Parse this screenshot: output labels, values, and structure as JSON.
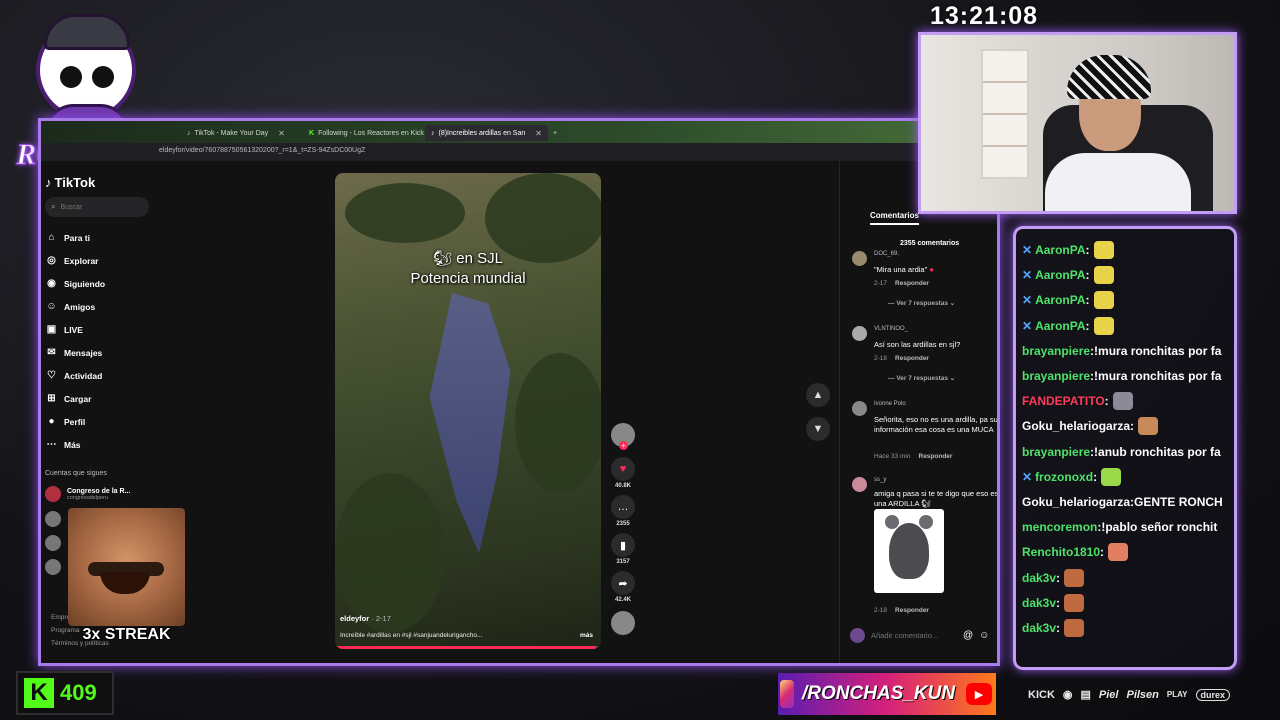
{
  "overlay": {
    "clock": "13:21:08",
    "logo_text": "RONCHAS",
    "streak_label": "3x STREAK",
    "kick_count": "409",
    "social_handle": "/RONCHAS_KUN",
    "sponsors": [
      "KICK",
      "Piel",
      "Pilsen",
      "PLAY",
      "durex"
    ]
  },
  "browser": {
    "tabs": [
      {
        "label": "TikTok - Make Your Day",
        "active": false
      },
      {
        "label": "Following - Los Reactores en Kick",
        "active": false
      },
      {
        "label": "(8)Increibles ardillas en San",
        "active": true
      }
    ],
    "url": "eldeyfor/video/760788750561320200?_r=1&_t=ZS-94ZsDC00UgZ"
  },
  "tiktok": {
    "brand": "TikTok",
    "search_placeholder": "Buscar",
    "nav": [
      {
        "label": "Para ti",
        "icon": "home-icon"
      },
      {
        "label": "Explorar",
        "icon": "compass-icon"
      },
      {
        "label": "Siguiendo",
        "icon": "following-icon"
      },
      {
        "label": "Amigos",
        "icon": "friends-icon"
      },
      {
        "label": "LIVE",
        "icon": "live-icon"
      },
      {
        "label": "Mensajes",
        "icon": "messages-icon"
      },
      {
        "label": "Actividad",
        "icon": "activity-icon"
      },
      {
        "label": "Cargar",
        "icon": "upload-icon"
      },
      {
        "label": "Perfil",
        "icon": "profile-icon"
      },
      {
        "label": "Más",
        "icon": "more-icon"
      }
    ],
    "following_title": "Cuentas que sigues",
    "following": [
      {
        "name": "Congreso de la R...",
        "handle": "congresodelperu"
      }
    ],
    "footer_links": [
      "Empresa",
      "Programa",
      "Términos y políticas"
    ]
  },
  "video": {
    "caption_line1": "en SJL",
    "caption_line2": "Potencia mundial",
    "author": "eldeyfor",
    "date": "· 2-17",
    "description": "Increíble #ardillas en #sjl #sanjuandelurigancho...",
    "more": "más",
    "progress": 0.98,
    "likes": "40.8K",
    "comments": "2355",
    "saves": "3157",
    "shares": "42.4K"
  },
  "comments_panel": {
    "tab": "Comentarios",
    "count_label": "2355 comentarios",
    "items": [
      {
        "user": "DOC_69.",
        "text": "\"Mira una ardia\"",
        "date": "2-17",
        "reply": "Responder",
        "more": "Ver 7 respuestas"
      },
      {
        "user": "VLNTINOO_",
        "text": "Así son las ardillas en sjl?",
        "date": "2-18",
        "reply": "Responder",
        "more": "Ver 7 respuestas"
      },
      {
        "user": "Ivonne Polo",
        "text": "Señorita, eso no es una ardilla, pa su información esa cosa es una MUCA",
        "date": "Hace 33 min",
        "reply": "Responder"
      },
      {
        "user": "ss_y",
        "text": "amiga q pasa si te te digo que eso es una ARDILLA",
        "date": "2-18",
        "reply": "Responder"
      }
    ],
    "input_placeholder": "Añadir comentario..."
  },
  "chat": {
    "messages": [
      {
        "user": "AaronPA",
        "text": "",
        "color": "#4de36a",
        "badge": true,
        "emote": "#e8d44a"
      },
      {
        "user": "AaronPA",
        "text": "",
        "color": "#4de36a",
        "badge": true,
        "emote": "#e8d44a"
      },
      {
        "user": "AaronPA",
        "text": "",
        "color": "#4de36a",
        "badge": true,
        "emote": "#e8d44a"
      },
      {
        "user": "AaronPA",
        "text": "",
        "color": "#4de36a",
        "badge": true,
        "emote": "#e8d44a"
      },
      {
        "user": "brayanpiere",
        "text": "!mura ronchitas por fa",
        "color": "#4de36a",
        "badge": false
      },
      {
        "user": "brayanpiere",
        "text": "!mura ronchitas por fa",
        "color": "#4de36a",
        "badge": false
      },
      {
        "user": "FANDEPATITO",
        "text": "",
        "color": "#ff3b5c",
        "badge": false,
        "emote": "#8a8a98"
      },
      {
        "user": "Goku_helariogarza",
        "text": "",
        "color": "#ffffff",
        "badge": false,
        "emote": "#c98a5a"
      },
      {
        "user": "brayanpiere",
        "text": "!anub ronchitas por fa",
        "color": "#4de36a",
        "badge": false
      },
      {
        "user": "frozonoxd",
        "text": "",
        "color": "#4de36a",
        "badge": true,
        "emote": "#9bd94a"
      },
      {
        "user": "Goku_helariogarza",
        "text": "GENTE RONCH",
        "color": "#ffffff",
        "badge": false
      },
      {
        "user": "mencoremon",
        "text": "!pablo señor ronchit",
        "color": "#4de36a",
        "badge": false
      },
      {
        "user": "Renchito1810",
        "text": "",
        "color": "#4de36a",
        "badge": false,
        "emote": "#e08060"
      },
      {
        "user": "dak3v",
        "text": "",
        "color": "#4de36a",
        "badge": false,
        "emote": "#c06a40"
      },
      {
        "user": "dak3v",
        "text": "",
        "color": "#4de36a",
        "badge": false,
        "emote": "#c06a40"
      },
      {
        "user": "dak3v",
        "text": "",
        "color": "#4de36a",
        "badge": false,
        "emote": "#c06a40"
      }
    ]
  },
  "colors": {
    "accent": "#a77be9",
    "kick_green": "#53fc18",
    "tiktok_red": "#fe2c55"
  }
}
